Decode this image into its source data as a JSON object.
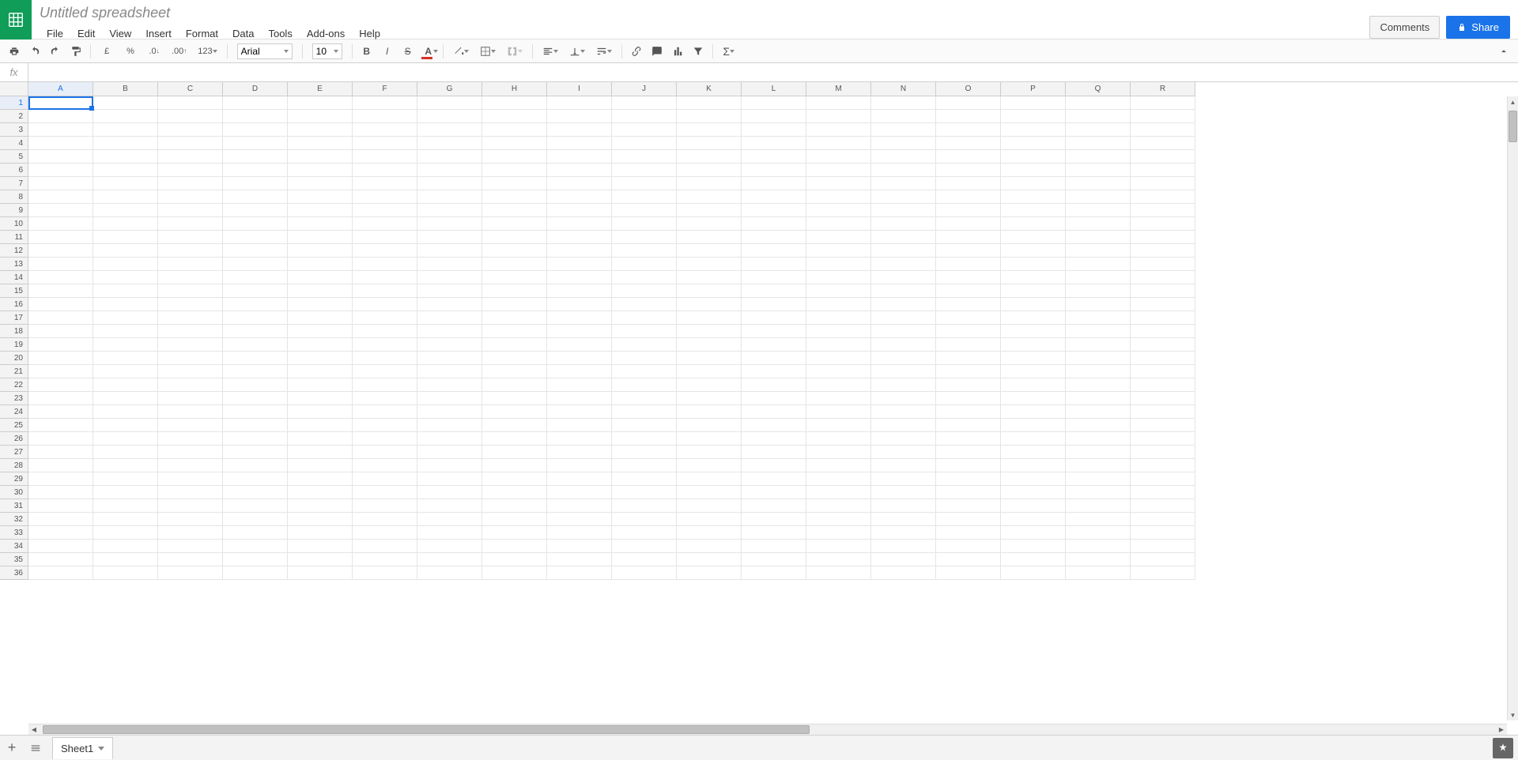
{
  "header": {
    "title": "Untitled spreadsheet",
    "comments_label": "Comments",
    "share_label": "Share"
  },
  "menus": [
    "File",
    "Edit",
    "View",
    "Insert",
    "Format",
    "Data",
    "Tools",
    "Add-ons",
    "Help"
  ],
  "toolbar": {
    "currency_symbol": "£",
    "percent": "%",
    "decimal_dec": ".0",
    "decimal_inc": ".00",
    "number_format": "123",
    "font": "Arial",
    "font_size": "10"
  },
  "formula_bar": {
    "fx_label": "fx",
    "value": ""
  },
  "columns": [
    "A",
    "B",
    "C",
    "D",
    "E",
    "F",
    "G",
    "H",
    "I",
    "J",
    "K",
    "L",
    "M",
    "N",
    "O",
    "P",
    "Q",
    "R"
  ],
  "rows": [
    "1",
    "2",
    "3",
    "4",
    "5",
    "6",
    "7",
    "8",
    "9",
    "10",
    "11",
    "12",
    "13",
    "14",
    "15",
    "16",
    "17",
    "18",
    "19",
    "20",
    "21",
    "22",
    "23",
    "24",
    "25",
    "26",
    "27",
    "28",
    "29",
    "30",
    "31",
    "32",
    "33",
    "34",
    "35",
    "36"
  ],
  "selected_cell": {
    "row": 0,
    "col": 0
  },
  "sheets": {
    "active": "Sheet1"
  }
}
